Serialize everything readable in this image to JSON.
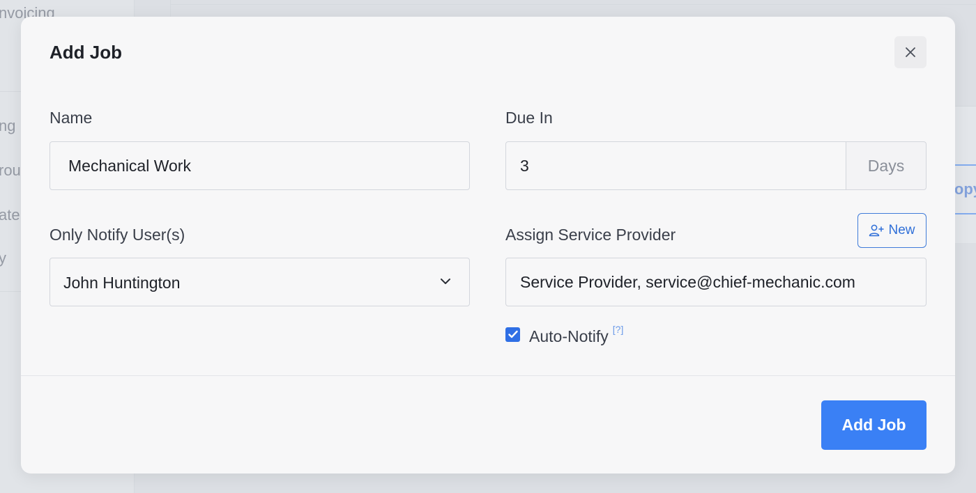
{
  "background": {
    "sidebar_items": [
      "nvoicing",
      "ng",
      "rou",
      "ate",
      "y"
    ],
    "copy_button_label": "opy"
  },
  "modal": {
    "title": "Add Job",
    "close_icon": "close-icon",
    "fields": {
      "name": {
        "label": "Name",
        "value": "Mechanical Work"
      },
      "due_in": {
        "label": "Due In",
        "value": "3",
        "unit": "Days"
      },
      "notify_users": {
        "label": "Only Notify User(s)",
        "selected": "John Huntington"
      },
      "service_provider": {
        "label": "Assign Service Provider",
        "value": "Service Provider, service@chief-mechanic.com",
        "new_button_label": "New"
      },
      "auto_notify": {
        "label": "Auto-Notify",
        "checked": true,
        "help_label": "[?]"
      }
    },
    "submit_label": "Add Job"
  },
  "colors": {
    "primary": "#3a80f5",
    "outline_blue": "#3f7bd9",
    "modal_bg": "#f7f7f8"
  }
}
